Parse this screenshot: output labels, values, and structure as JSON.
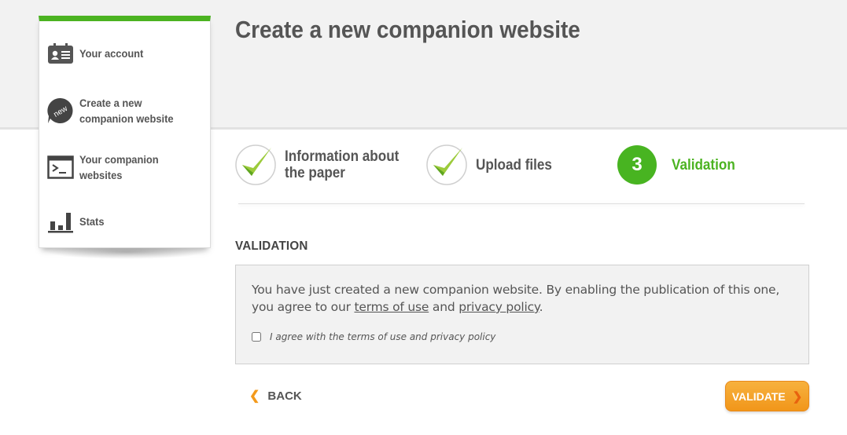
{
  "page": {
    "title": "Create a new companion website"
  },
  "sidebar": {
    "items": [
      {
        "label": "Your account",
        "icon": "id-card-icon"
      },
      {
        "label": "Create a new companion website",
        "icon": "new-badge-icon",
        "badge": "new"
      },
      {
        "label": "Your companion websites",
        "icon": "terminal-window-icon"
      },
      {
        "label": "Stats",
        "icon": "bar-chart-icon"
      }
    ]
  },
  "steps": [
    {
      "label": "Information about the paper",
      "status": "done"
    },
    {
      "label": "Upload files",
      "status": "done"
    },
    {
      "number": "3",
      "label": "Validation",
      "status": "active"
    }
  ],
  "validation": {
    "heading": "VALIDATION",
    "text_before": "You have just created a new companion website. By enabling the publication of this one, you agree to our ",
    "terms_link": "terms of use",
    "text_and": " and ",
    "privacy_link": "privacy policy",
    "text_end": ".",
    "checkbox_label": "I agree with the terms of use and privacy policy",
    "checkbox_checked": false
  },
  "actions": {
    "back_label": "BACK",
    "validate_label": "VALIDATE"
  },
  "colors": {
    "accent_green": "#4bb321",
    "orange": "#f39a1c"
  }
}
